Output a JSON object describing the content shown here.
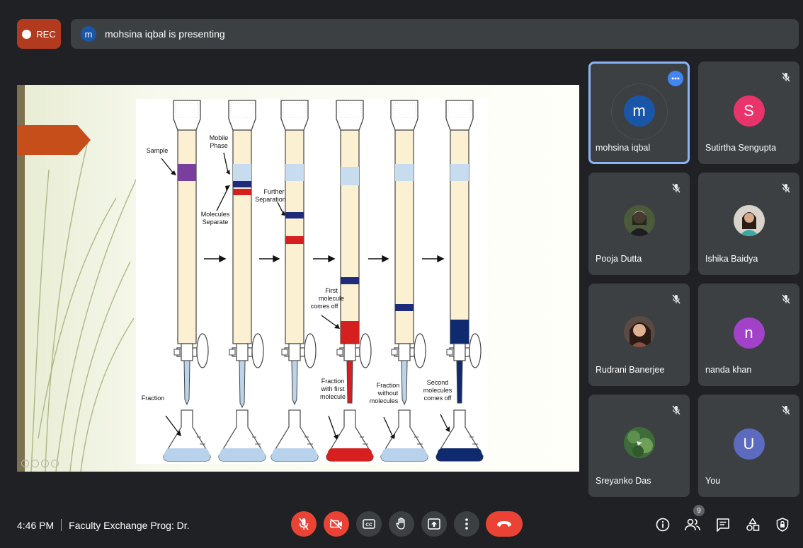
{
  "recording": {
    "label": "REC"
  },
  "presenter_bar": {
    "avatar_initial": "m",
    "text": "mohsina iqbal is presenting"
  },
  "slide": {
    "labels": {
      "sample": "Sample",
      "mobile_phase_1": "Mobile",
      "mobile_phase_2": "Phase",
      "molecules_separate_1": "Molecules",
      "molecules_separate_2": "Separate",
      "further_separation_1": "Further",
      "further_separation_2": "Separation",
      "first_molecule_1": "First",
      "first_molecule_2": "molecule",
      "first_molecule_3": "comes off",
      "fraction": "Fraction",
      "fraction_first_1": "Fraction",
      "fraction_first_2": "with first",
      "fraction_first_3": "molecule",
      "fraction_without_1": "Fraction",
      "fraction_without_2": "without",
      "fraction_without_3": "molecules",
      "second_molecule_1": "Second",
      "second_molecule_2": "molecules",
      "second_molecule_3": "comes off"
    }
  },
  "participants": [
    {
      "name": "mohsina iqbal",
      "initial": "m",
      "avatar_color": "#1a56a8",
      "speaking": true
    },
    {
      "name": "Sutirtha Sengupta",
      "initial": "S",
      "avatar_color": "#e8336b",
      "muted": true
    },
    {
      "name": "Pooja Dutta",
      "photo": true,
      "muted": true
    },
    {
      "name": "Ishika Baidya",
      "photo": true,
      "muted": true
    },
    {
      "name": "Rudrani Banerjee",
      "photo": true,
      "muted": true
    },
    {
      "name": "nanda khan",
      "initial": "n",
      "avatar_color": "#a142c8",
      "muted": true
    },
    {
      "name": "Sreyanko Das",
      "photo": true,
      "muted": true
    },
    {
      "name": "You",
      "initial": "U",
      "avatar_color": "#5c6bc0",
      "muted": true
    }
  ],
  "bottom_bar": {
    "time": "4:46 PM",
    "meeting_title": "Faculty Exchange Prog: Dr.",
    "participant_count": "9"
  },
  "colors": {
    "background": "#202124",
    "tile": "#3c4043",
    "danger": "#ea4335",
    "accent": "#8ab4f8",
    "rec": "#b23a1e"
  }
}
